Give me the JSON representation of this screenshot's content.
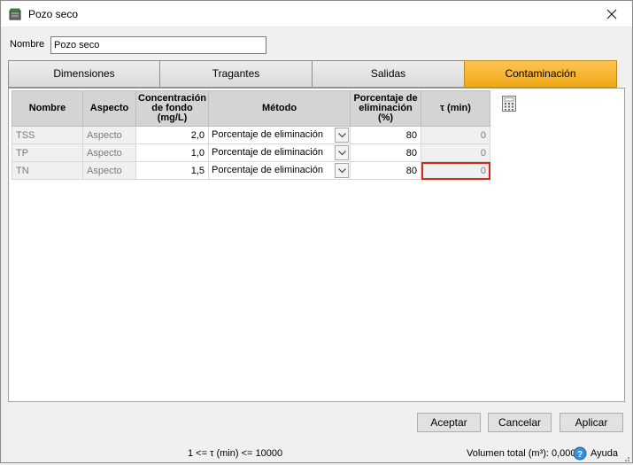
{
  "window": {
    "title": "Pozo seco",
    "close_icon": "close-icon",
    "app_icon": "dry-well-icon"
  },
  "name_field": {
    "label": "Nombre",
    "value": "Pozo seco"
  },
  "tabs": [
    {
      "label": "Dimensiones",
      "active": false
    },
    {
      "label": "Tragantes",
      "active": false
    },
    {
      "label": "Salidas",
      "active": false
    },
    {
      "label": "Contaminación",
      "active": true
    }
  ],
  "table": {
    "headers": {
      "nombre": "Nombre",
      "aspecto": "Aspecto",
      "concentracion": "Concentración de fondo (mg/L)",
      "metodo": "Método",
      "porcentaje": "Porcentaje de eliminación (%)",
      "tau": "τ (min)"
    },
    "rows": [
      {
        "nombre": "TSS",
        "aspecto": "Aspecto",
        "concentracion": "2,0",
        "metodo": "Porcentaje de eliminación",
        "porcentaje": "80",
        "tau": "0"
      },
      {
        "nombre": "TP",
        "aspecto": "Aspecto",
        "concentracion": "1,0",
        "metodo": "Porcentaje de eliminación",
        "porcentaje": "80",
        "tau": "0"
      },
      {
        "nombre": "TN",
        "aspecto": "Aspecto",
        "concentracion": "1,5",
        "metodo": "Porcentaje de eliminación",
        "porcentaje": "80",
        "tau": "0"
      }
    ],
    "selected_cell": "TN τ (min)"
  },
  "calculator_icon": "calculator-icon",
  "buttons": {
    "accept": "Aceptar",
    "cancel": "Cancelar",
    "apply": "Aplicar"
  },
  "status": {
    "range": "1 <= τ (min) <= 10000",
    "volume": "Volumen total (m³): 0,000",
    "help": "Ayuda"
  },
  "colors": {
    "active_tab": "#f7b733",
    "selection_border": "#d9261c",
    "header_bg": "#d4d4d4"
  }
}
